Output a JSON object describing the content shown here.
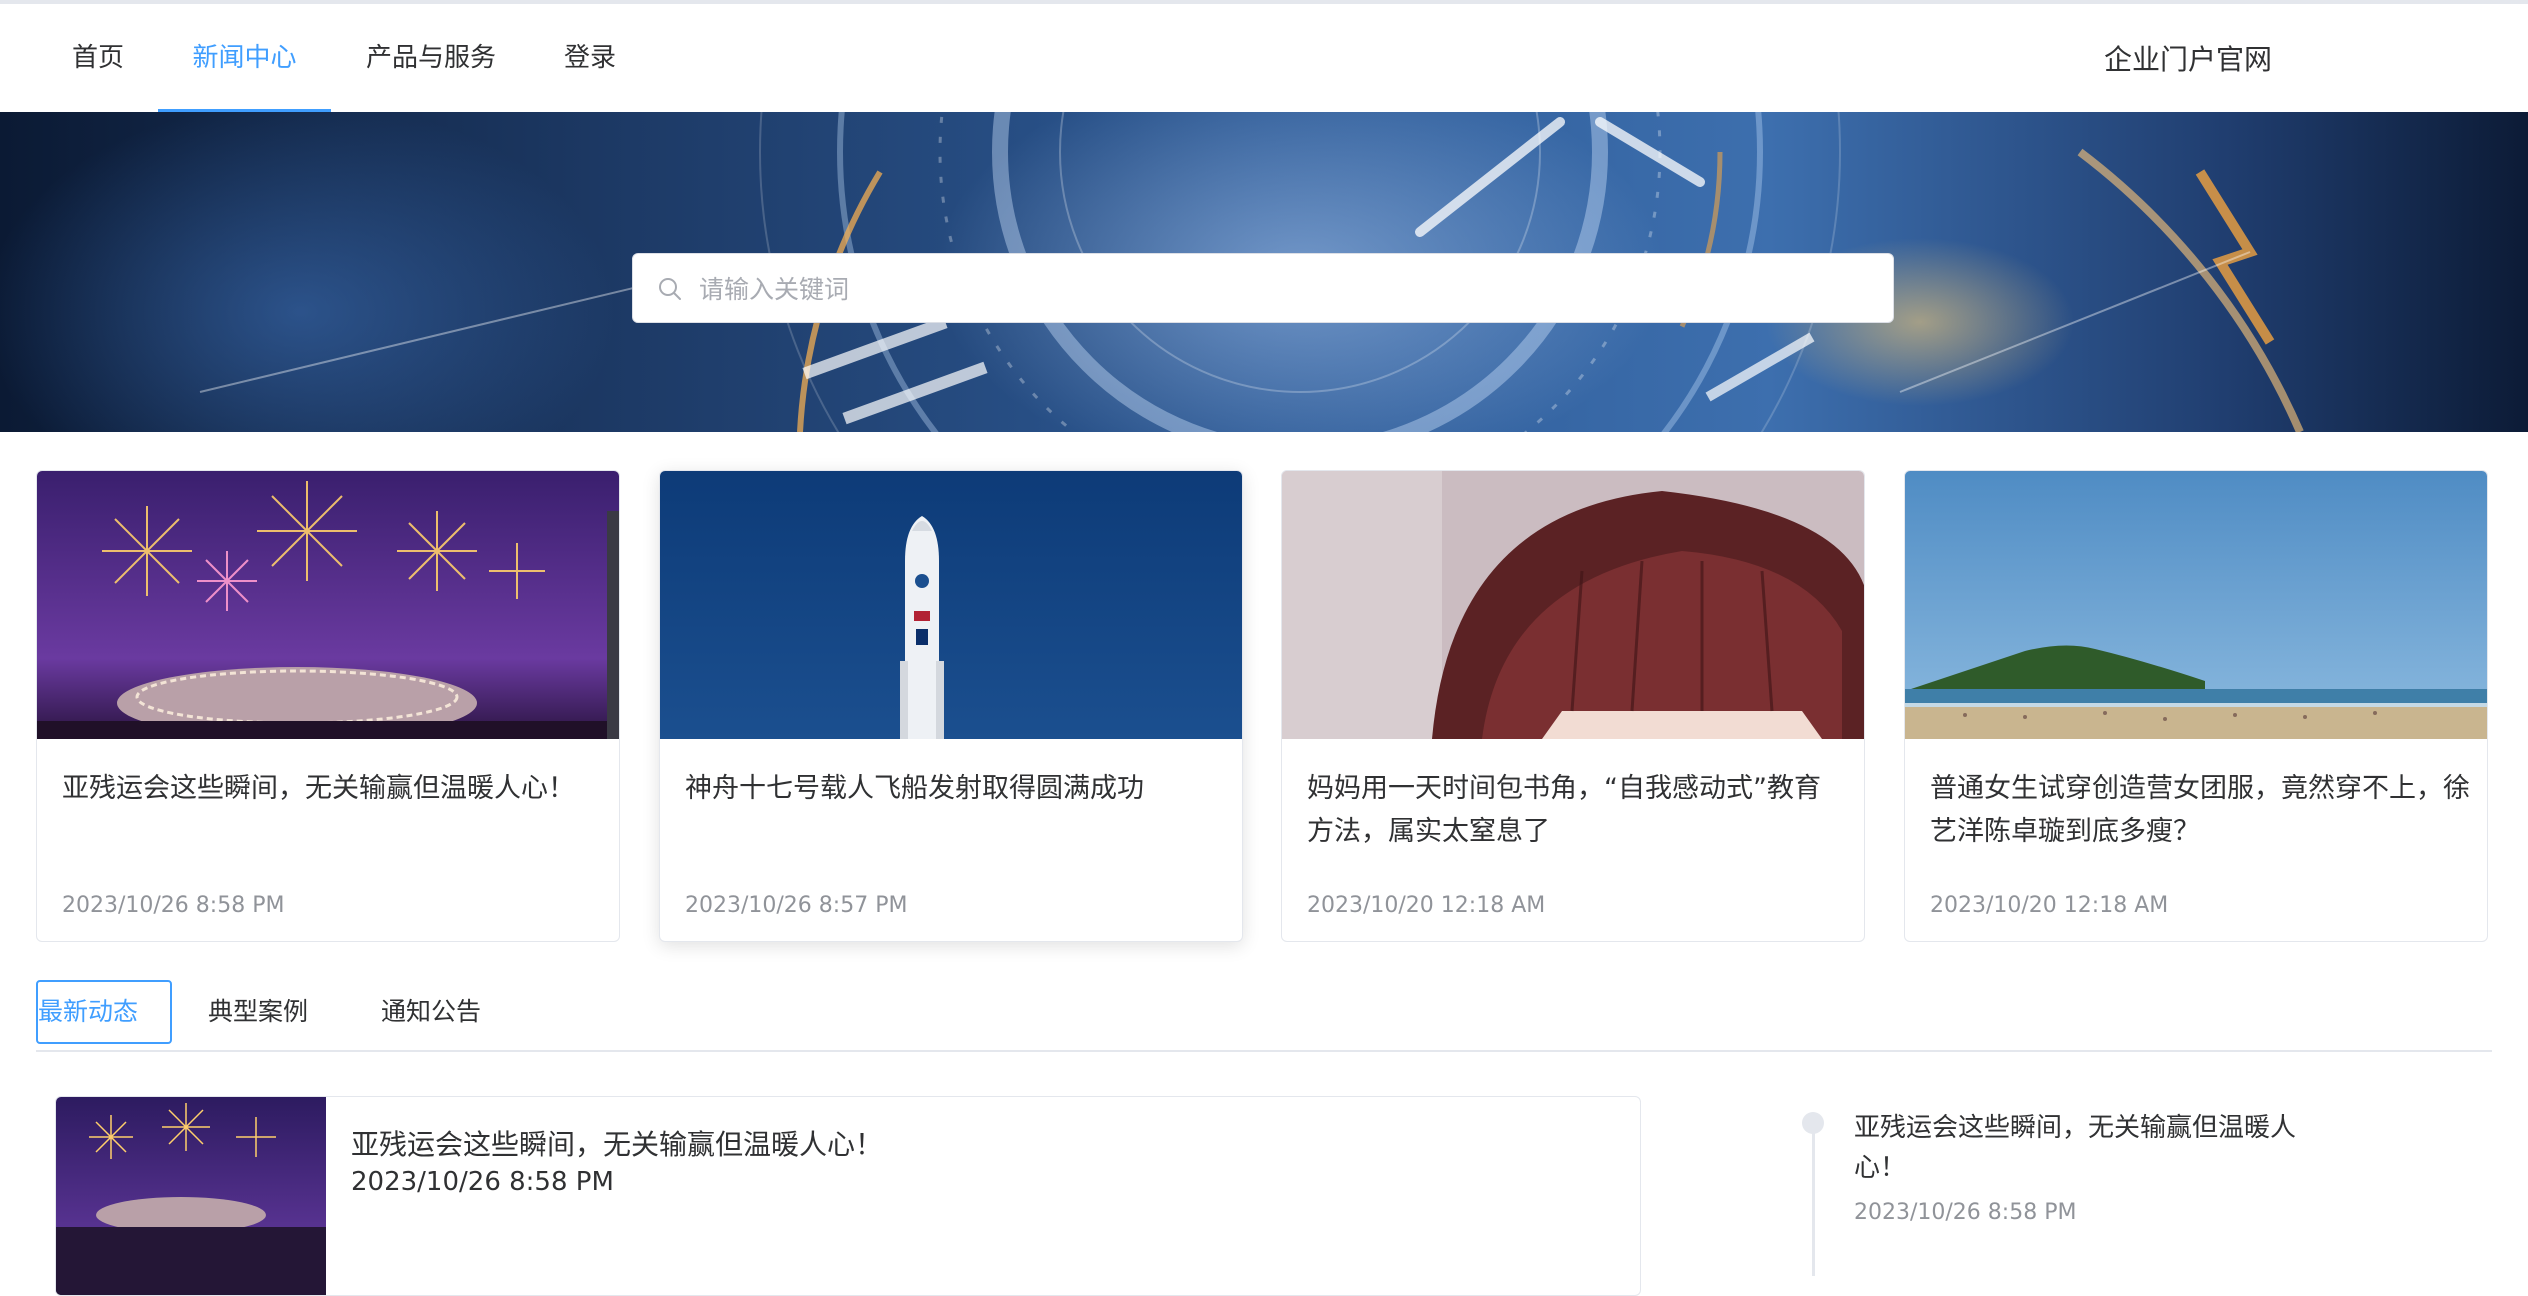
{
  "nav": {
    "items": [
      {
        "label": "首页"
      },
      {
        "label": "新闻中心"
      },
      {
        "label": "产品与服务"
      },
      {
        "label": "登录"
      }
    ],
    "active_index": 1,
    "brand": "企业门户官网"
  },
  "search": {
    "placeholder": "请输入关键词",
    "value": ""
  },
  "cards": [
    {
      "title": "亚残运会这些瞬间，无关输赢但温暖人心！",
      "date": "2023/10/26 8:58 PM",
      "image": "fireworks-stadium"
    },
    {
      "title": "神舟十七号载人飞船发射取得圆满成功",
      "date": "2023/10/26 8:57 PM",
      "image": "rocket-launch"
    },
    {
      "title": "妈妈用一天时间包书角，“自我感动式”教育方法，属实太窒息了",
      "date": "2023/10/20 12:18 AM",
      "image": "hair-bangs"
    },
    {
      "title": "普通女生试穿创造营女团服，竟然穿不上，徐艺洋陈卓璇到底多瘦？",
      "date": "2023/10/20 12:18 AM",
      "image": "beach-island"
    }
  ],
  "tabs": {
    "items": [
      {
        "label": "最新动态"
      },
      {
        "label": "典型案例"
      },
      {
        "label": "通知公告"
      }
    ],
    "active_index": 0
  },
  "list": [
    {
      "title": "亚残运会这些瞬间，无关输赢但温暖人心！",
      "date": "2023/10/26 8:58 PM",
      "image": "fireworks-stadium"
    }
  ],
  "timeline": [
    {
      "title": "亚残运会这些瞬间，无关输赢但温暖人心！",
      "date": "2023/10/26 8:58 PM"
    }
  ],
  "colors": {
    "accent": "#409eff",
    "text": "#303133",
    "muted": "#909399",
    "border": "#e4e7ed"
  }
}
